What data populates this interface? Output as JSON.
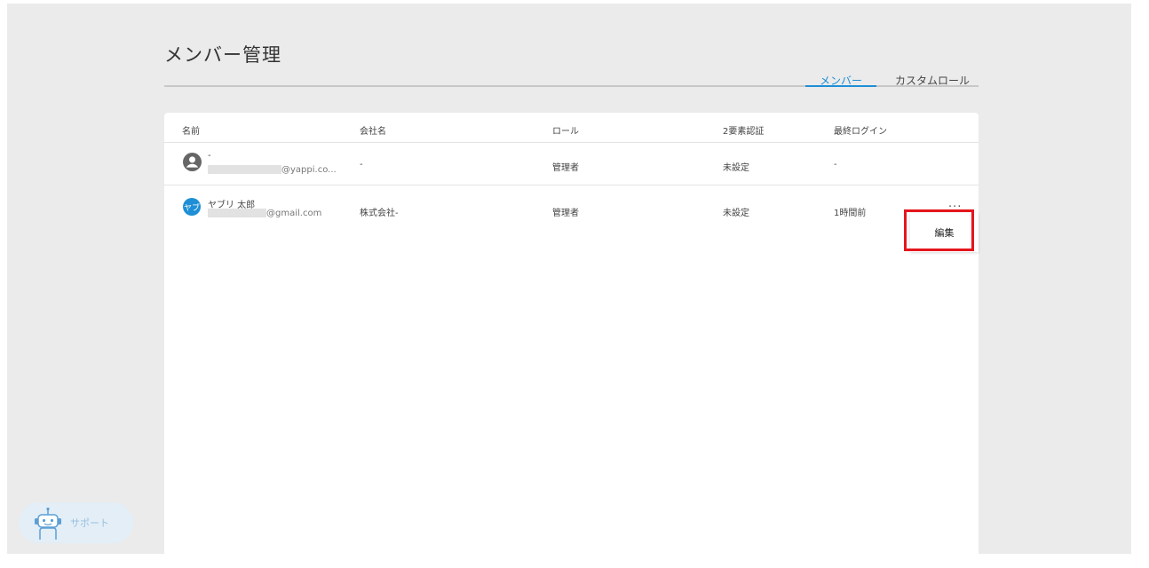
{
  "page": {
    "title": "メンバー管理"
  },
  "tabs": [
    {
      "label": "メンバー",
      "active": true
    },
    {
      "label": "カスタムロール",
      "active": false
    }
  ],
  "table": {
    "columns": [
      "名前",
      "会社名",
      "ロール",
      "2要素認証",
      "最終ログイン"
    ],
    "rows": [
      {
        "avatar": "person-icon",
        "name": "-",
        "email_suffix": "@yappi.co...",
        "company": "-",
        "role": "管理者",
        "two_factor": "未設定",
        "last_login": "-"
      },
      {
        "avatar_initial": "ヤブ",
        "name": "ヤブリ 太郎",
        "email_suffix": "@gmail.com",
        "company": "株式会社-",
        "role": "管理者",
        "two_factor": "未設定",
        "last_login": "1時間前",
        "more_label": "..."
      }
    ]
  },
  "row_menu": {
    "edit_label": "編集"
  },
  "support": {
    "label": "サポート"
  },
  "colors": {
    "accent": "#1e8fd6",
    "highlight": "#e6151c",
    "background": "#ebebeb"
  }
}
